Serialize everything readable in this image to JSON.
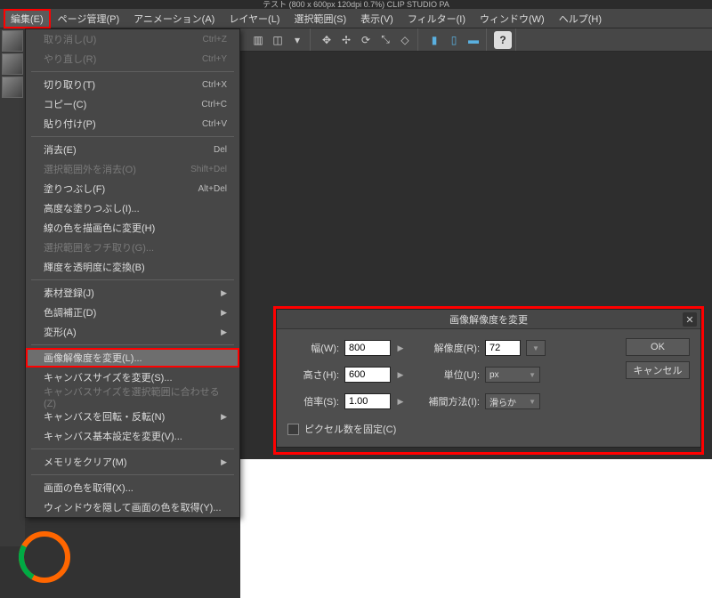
{
  "titlebar": "テスト (800 x 600px 120dpi 0.7%)    CLIP STUDIO PA",
  "menubar": [
    {
      "label": "編集(E)",
      "active": true
    },
    {
      "label": "ページ管理(P)"
    },
    {
      "label": "アニメーション(A)"
    },
    {
      "label": "レイヤー(L)"
    },
    {
      "label": "選択範囲(S)"
    },
    {
      "label": "表示(V)"
    },
    {
      "label": "フィルター(I)"
    },
    {
      "label": "ウィンドウ(W)"
    },
    {
      "label": "ヘルプ(H)"
    }
  ],
  "toolbar": {
    "icons": [
      "blank-icon",
      "window-icon",
      "dropdown-icon",
      "",
      "flip-h-icon",
      "move-icon",
      "rotate-icon",
      "scale-icon",
      "handles-icon",
      "",
      "layer-a-icon",
      "layer-b-icon",
      "layer-c-icon",
      "",
      "help-icon"
    ]
  },
  "dropdown": [
    {
      "label": "取り消し(U)",
      "shortcut": "Ctrl+Z",
      "disabled": true
    },
    {
      "label": "やり直し(R)",
      "shortcut": "Ctrl+Y",
      "disabled": true
    },
    {
      "sep": true
    },
    {
      "label": "切り取り(T)",
      "shortcut": "Ctrl+X"
    },
    {
      "label": "コピー(C)",
      "shortcut": "Ctrl+C"
    },
    {
      "label": "貼り付け(P)",
      "shortcut": "Ctrl+V"
    },
    {
      "sep": true
    },
    {
      "label": "消去(E)",
      "shortcut": "Del"
    },
    {
      "label": "選択範囲外を消去(O)",
      "shortcut": "Shift+Del",
      "disabled": true
    },
    {
      "label": "塗りつぶし(F)",
      "shortcut": "Alt+Del"
    },
    {
      "label": "高度な塗りつぶし(I)..."
    },
    {
      "label": "線の色を描画色に変更(H)"
    },
    {
      "label": "選択範囲をフチ取り(G)...",
      "disabled": true
    },
    {
      "label": "輝度を透明度に変換(B)"
    },
    {
      "sep": true
    },
    {
      "label": "素材登録(J)",
      "sub": true
    },
    {
      "label": "色調補正(D)",
      "sub": true
    },
    {
      "label": "変形(A)",
      "sub": true
    },
    {
      "sep": true
    },
    {
      "label": "画像解像度を変更(L)...",
      "highlighted": true
    },
    {
      "label": "キャンバスサイズを変更(S)..."
    },
    {
      "label": "キャンバスサイズを選択範囲に合わせる(Z)",
      "disabled": true
    },
    {
      "label": "キャンバスを回転・反転(N)",
      "sub": true
    },
    {
      "label": "キャンバス基本設定を変更(V)..."
    },
    {
      "sep": true
    },
    {
      "label": "メモリをクリア(M)",
      "sub": true
    },
    {
      "sep": true
    },
    {
      "label": "画面の色を取得(X)..."
    },
    {
      "label": "ウィンドウを隠して画面の色を取得(Y)..."
    }
  ],
  "dialog": {
    "title": "画像解像度を変更",
    "width_label": "幅(W):",
    "width_value": "800",
    "height_label": "高さ(H):",
    "height_value": "600",
    "scale_label": "倍率(S):",
    "scale_value": "1.00",
    "res_label": "解像度(R):",
    "res_value": "72",
    "unit_label": "単位(U):",
    "unit_value": "px",
    "interp_label": "補間方法(I):",
    "interp_value": "滑らか",
    "fix_pixels_label": "ピクセル数を固定(C)",
    "ok": "OK",
    "cancel": "キャンセル"
  }
}
